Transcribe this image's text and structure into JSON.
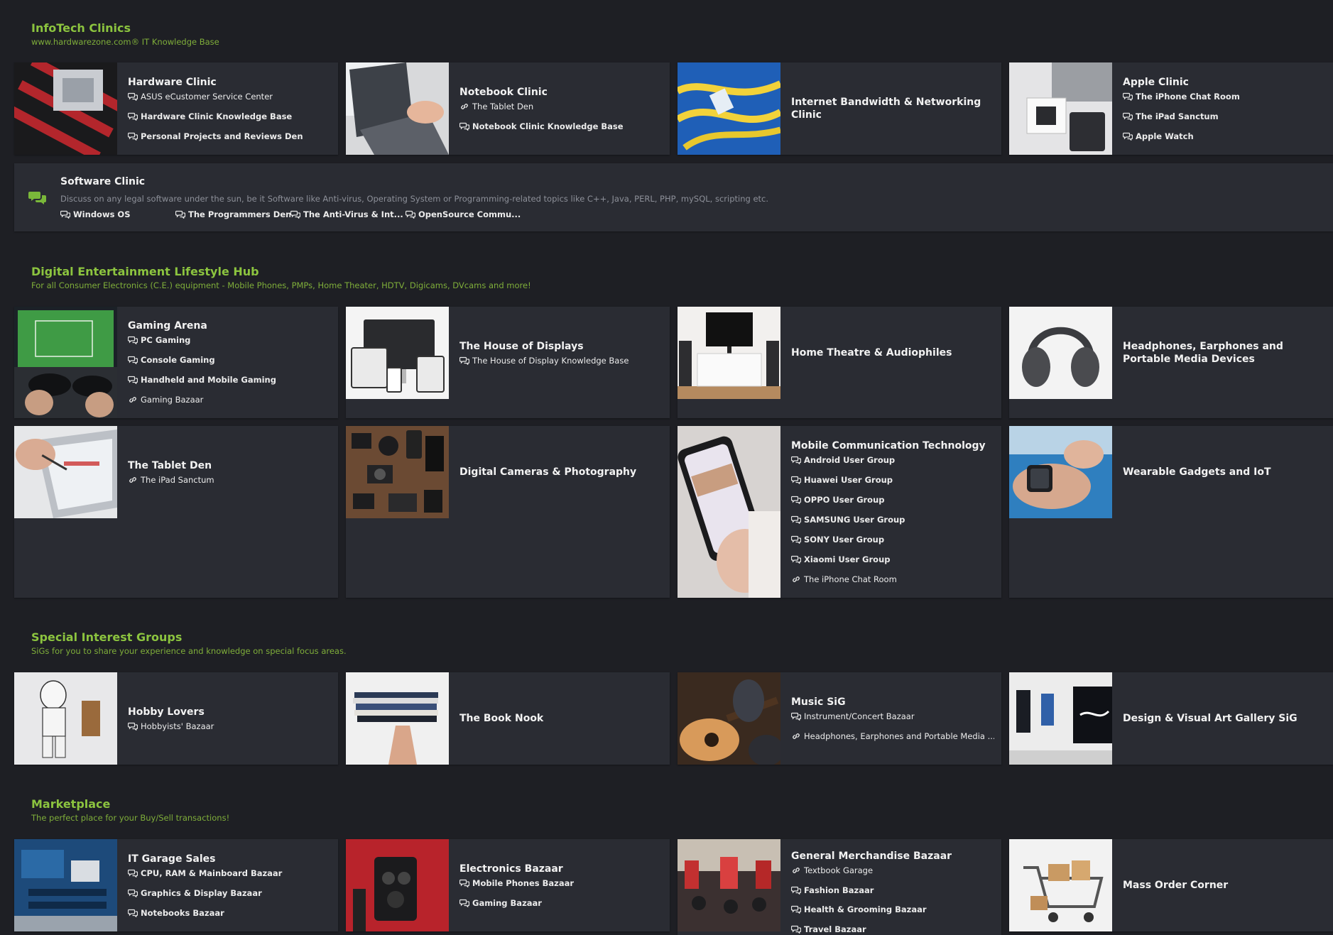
{
  "sections": {
    "infotech": {
      "title": "InfoTech Clinics",
      "desc": "www.hardwarezone.com® IT Knowledge Base"
    },
    "digital": {
      "title": "Digital Entertainment Lifestyle Hub",
      "desc": "For all Consumer Electronics (C.E.) equipment - Mobile Phones, PMPs, Home Theater, HDTV, Digicams, DVcams and more!"
    },
    "sigs": {
      "title": "Special Interest Groups",
      "desc": "SiGs for you to share your experience and knowledge on special focus areas."
    },
    "market": {
      "title": "Marketplace",
      "desc": "The perfect place for your Buy/Sell transactions!"
    }
  },
  "forums": {
    "hardware": {
      "title": "Hardware Clinic",
      "subs": [
        "ASUS eCustomer Service Center",
        "Hardware Clinic Knowledge Base",
        "Personal Projects and Reviews Den"
      ]
    },
    "notebook": {
      "title": "Notebook Clinic",
      "subs": [
        "The Tablet Den",
        "Notebook Clinic Knowledge Base"
      ]
    },
    "internet": {
      "title": "Internet Bandwidth & Networking Clinic"
    },
    "apple": {
      "title": "Apple Clinic",
      "subs": [
        "The iPhone Chat Room",
        "The iPad Sanctum",
        "Apple Watch"
      ]
    },
    "software": {
      "title": "Software Clinic",
      "desc": "Discuss on any legal software under the sun, be it Software like Anti-virus, Operating System or Programming-related topics like C++, Java, PERL, PHP, mySQL, scripting etc.",
      "subs": [
        "Windows OS",
        "The Programmers Den",
        "The Anti-Virus & Int...",
        "OpenSource Commu..."
      ]
    },
    "gaming": {
      "title": "Gaming Arena",
      "subs": [
        "PC Gaming",
        "Console Gaming",
        "Handheld and Mobile Gaming",
        "Gaming Bazaar"
      ]
    },
    "displays": {
      "title": "The House of Displays",
      "subs": [
        "The House of Display Knowledge Base"
      ]
    },
    "hometheatre": {
      "title": "Home Theatre & Audiophiles"
    },
    "headphones": {
      "title": "Headphones, Earphones and Portable Media Devices"
    },
    "tablet": {
      "title": "The Tablet Den",
      "subs": [
        "The iPad Sanctum"
      ]
    },
    "cameras": {
      "title": "Digital Cameras & Photography"
    },
    "mobile": {
      "title": "Mobile Communication Technology",
      "subs": [
        "Android User Group",
        "Huawei User Group",
        "OPPO User Group",
        "SAMSUNG User Group",
        "SONY User Group",
        "Xiaomi User Group",
        "The iPhone Chat Room"
      ]
    },
    "wearable": {
      "title": "Wearable Gadgets and IoT"
    },
    "hobby": {
      "title": "Hobby Lovers",
      "subs": [
        "Hobbyists' Bazaar"
      ]
    },
    "book": {
      "title": "The Book Nook"
    },
    "music": {
      "title": "Music SiG",
      "subs": [
        "Instrument/Concert Bazaar",
        "Headphones, Earphones and Portable Media ..."
      ]
    },
    "design": {
      "title": "Design & Visual Art Gallery SiG"
    },
    "itgarage": {
      "title": "IT Garage Sales",
      "subs": [
        "CPU, RAM & Mainboard Bazaar",
        "Graphics & Display Bazaar",
        "Notebooks Bazaar"
      ]
    },
    "electronics": {
      "title": "Electronics Bazaar",
      "subs": [
        "Mobile Phones Bazaar",
        "Gaming Bazaar"
      ]
    },
    "general": {
      "title": "General Merchandise Bazaar",
      "subs": [
        "Textbook Garage",
        "Fashion Bazaar",
        "Health & Grooming Bazaar",
        "Travel Bazaar"
      ]
    },
    "massorder": {
      "title": "Mass Order Corner"
    }
  },
  "icons": {
    "chat": "chat-bubbles-icon",
    "link": "link-icon",
    "software": "comments-icon"
  },
  "colors": {
    "accent": "#8cc43f",
    "card": "#2a2c33",
    "background": "#1e1f24"
  }
}
